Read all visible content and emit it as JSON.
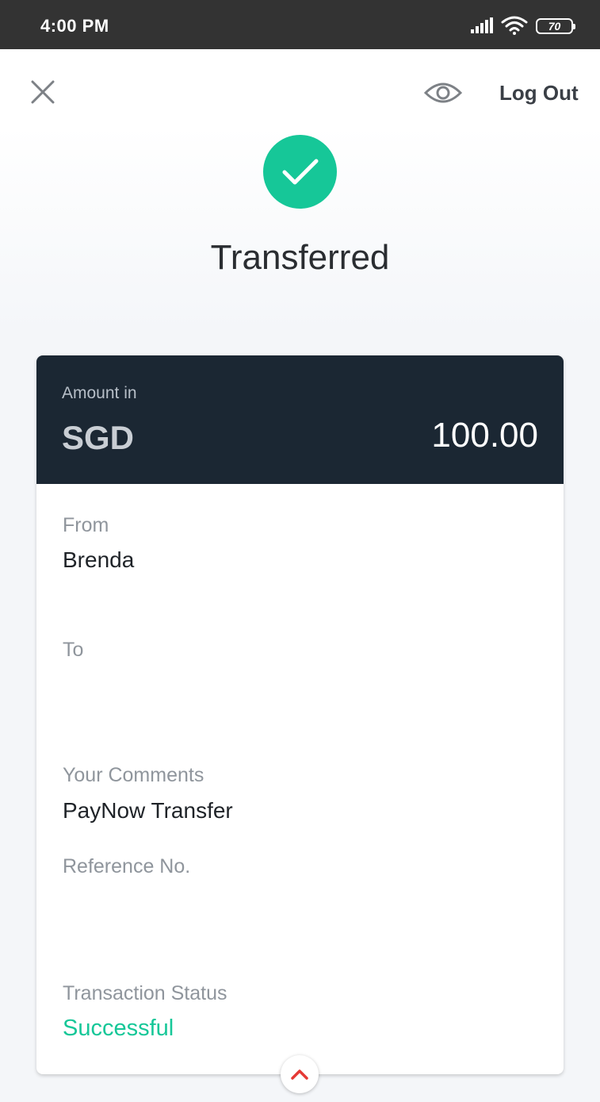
{
  "status_bar": {
    "time": "4:00 PM",
    "battery_level": "70",
    "icons": [
      "signal-icon",
      "wifi-icon",
      "battery-icon"
    ]
  },
  "header": {
    "close_icon": "close-icon",
    "visibility_icon": "eye-icon",
    "logout_label": "Log Out"
  },
  "result": {
    "icon": "check-circle-icon",
    "title": "Transferred"
  },
  "amount": {
    "caption": "Amount in",
    "currency": "SGD",
    "value": "100.00"
  },
  "details": {
    "from_label": "From",
    "from_value": "Brenda",
    "to_label": "To",
    "to_value": "",
    "comments_label": "Your Comments",
    "comments_value": "PayNow Transfer",
    "reference_label": "Reference No.",
    "reference_value": "",
    "status_label": "Transaction Status",
    "status_value": "Successful"
  },
  "expand_icon": "chevron-up-icon",
  "colors": {
    "status_bar": "#333333",
    "success_green": "#16c798",
    "card_header": "#1b2733",
    "accent_red": "#e53935"
  }
}
